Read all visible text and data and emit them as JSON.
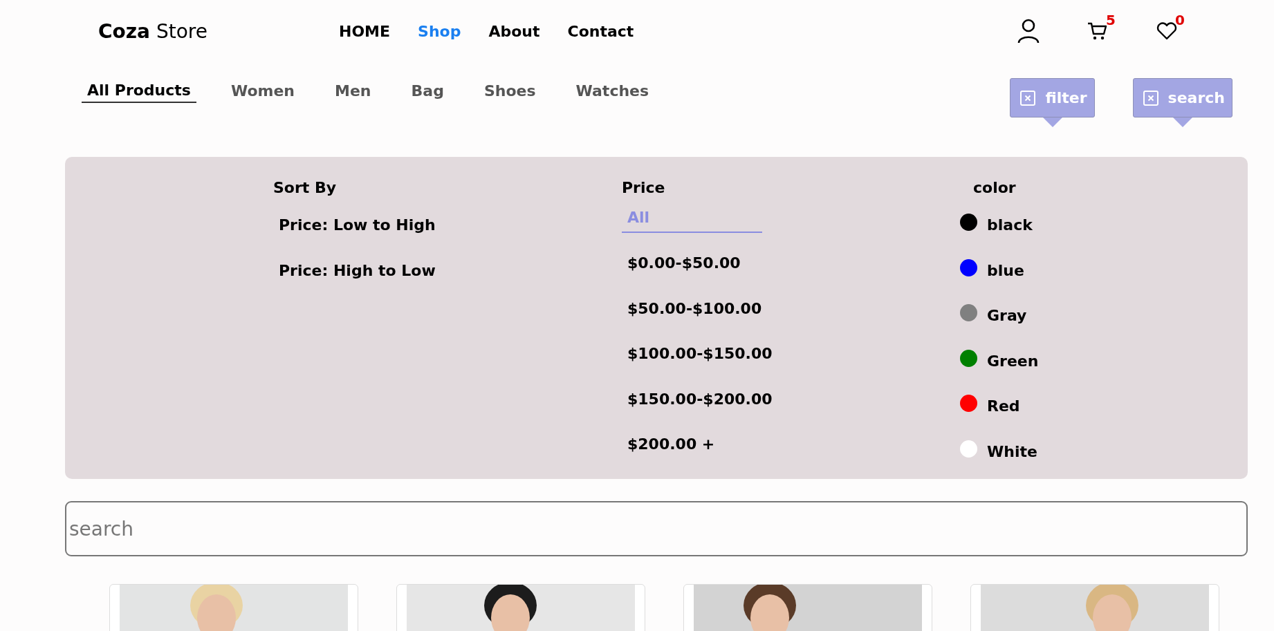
{
  "logo": {
    "bold": "Coza",
    "rest": "Store"
  },
  "nav": [
    {
      "label": "HOME",
      "selected": false
    },
    {
      "label": "Shop",
      "selected": true
    },
    {
      "label": "About",
      "selected": false
    },
    {
      "label": "Contact",
      "selected": false
    }
  ],
  "header_icons": {
    "cart_count": "5",
    "wishlist_count": "0"
  },
  "categories": [
    {
      "label": "All Products",
      "selected": true
    },
    {
      "label": "Women",
      "selected": false
    },
    {
      "label": "Men",
      "selected": false
    },
    {
      "label": "Bag",
      "selected": false
    },
    {
      "label": "Shoes",
      "selected": false
    },
    {
      "label": "Watches",
      "selected": false
    }
  ],
  "toggles": [
    {
      "label": "filter"
    },
    {
      "label": "search"
    }
  ],
  "filter_panel": {
    "sort": {
      "title": "Sort By",
      "options": [
        "Price: Low to High",
        "Price: High to Low"
      ]
    },
    "price": {
      "title": "Price",
      "options": [
        {
          "label": "All",
          "selected": true
        },
        {
          "label": "$0.00-$50.00",
          "selected": false
        },
        {
          "label": "$50.00-$100.00",
          "selected": false
        },
        {
          "label": "$100.00-$150.00",
          "selected": false
        },
        {
          "label": "$150.00-$200.00",
          "selected": false
        },
        {
          "label": "$200.00 +",
          "selected": false
        }
      ]
    },
    "color": {
      "title": "color",
      "options": [
        {
          "label": "black",
          "color": "#000000"
        },
        {
          "label": "blue",
          "color": "#0000ff"
        },
        {
          "label": "Gray",
          "color": "#808080"
        },
        {
          "label": "Green",
          "color": "#008000"
        },
        {
          "label": "Red",
          "color": "#ff0000"
        },
        {
          "label": "White",
          "color": "#ffffff"
        }
      ]
    }
  },
  "search": {
    "placeholder": "search"
  }
}
